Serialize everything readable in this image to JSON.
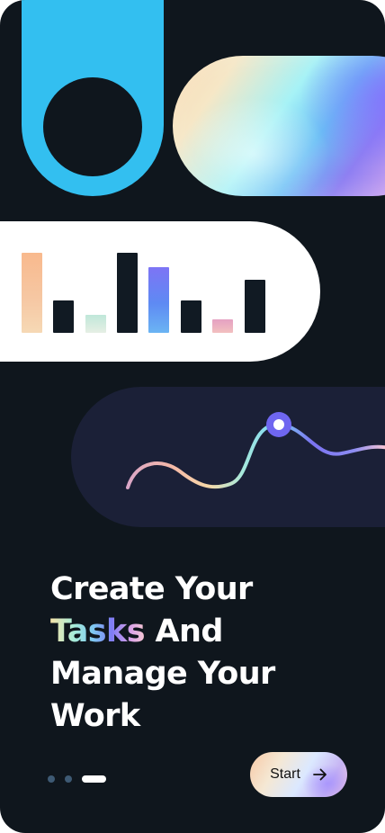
{
  "onboarding": {
    "title_line1": "Create Your",
    "title_highlight": "Tasks",
    "title_line2_rest": " And",
    "title_line3": "Manage Your",
    "title_line4": "Work",
    "start_label": "Start",
    "pager": {
      "total_pages": 3,
      "active_page": 3
    }
  },
  "colors": {
    "background": "#0f161d",
    "accent_blue": "#33bff0",
    "card_white": "#ffffff",
    "card_navy": "#1b2037",
    "dot_inactive": "#3e5a74",
    "dot_active": "#ffffff"
  },
  "icons": {
    "start_button": "arrow-right-icon",
    "line_chart_marker": "chart-point-marker"
  }
}
